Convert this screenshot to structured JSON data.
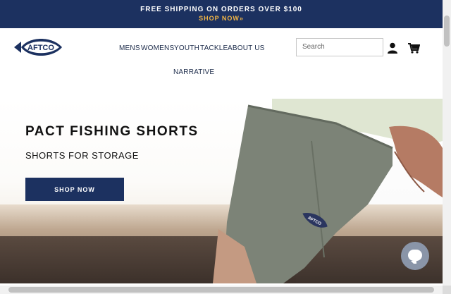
{
  "announcement": {
    "line1": "FREE SHIPPING ON ORDERS OVER $100",
    "line2": "SHOP NOW»"
  },
  "header": {
    "logo_text": "AFTCO",
    "nav": [
      "MENS",
      "WOMENS",
      "YOUTH",
      "TACKLE",
      "ABOUT US",
      "NARRATIVE"
    ],
    "search_placeholder": "Search",
    "icons": [
      "account-icon",
      "cart-icon"
    ]
  },
  "hero": {
    "title": "PACT FISHING SHORTS",
    "subtitle": "SHORTS FOR STORAGE",
    "button": "SHOP NOW",
    "patch_text": "AFTCO"
  },
  "colors": {
    "navy": "#1c3160",
    "accent": "#f2b544",
    "chat": "#8a95a8"
  }
}
